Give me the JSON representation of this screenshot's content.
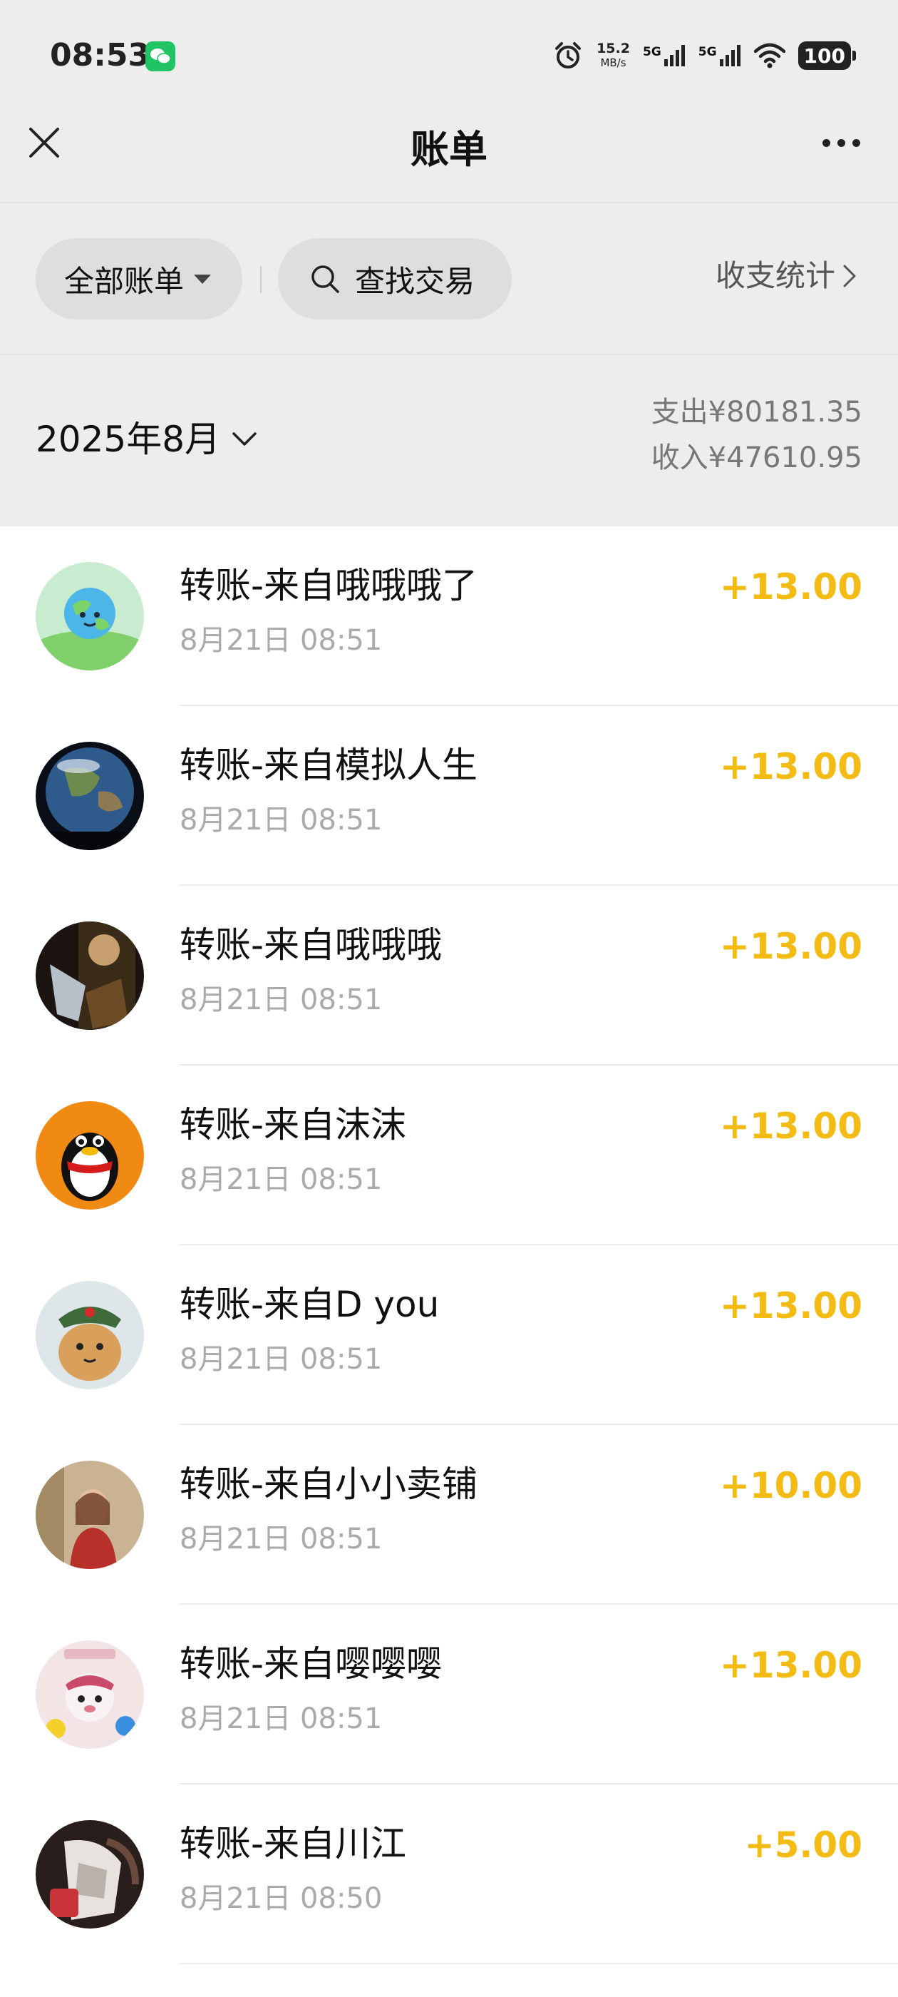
{
  "status_bar": {
    "time": "08:53",
    "app_notification_icon": "wechat-icon",
    "net_speed_value": "15.2",
    "net_speed_unit": "MB/s",
    "sim1_label": "5G",
    "sim2_label": "5G",
    "battery": "100"
  },
  "nav": {
    "title": "账单",
    "close_icon": "close-icon",
    "more_icon": "more-icon"
  },
  "filters": {
    "all_bills_label": "全部账单",
    "search_label": "查找交易",
    "stats_label": "收支统计"
  },
  "month": {
    "label": "2025年8月",
    "expense": "支出¥80181.35",
    "income": "收入¥47610.95"
  },
  "colors": {
    "amount": "#f3bb14",
    "background": "#ededed",
    "pill": "#dedede"
  },
  "transactions": [
    {
      "title": "转账-来自哦哦哦了",
      "time": "8月21日 08:51",
      "amount": "+13.00"
    },
    {
      "title": "转账-来自模拟人生",
      "time": "8月21日 08:51",
      "amount": "+13.00"
    },
    {
      "title": "转账-来自哦哦哦",
      "time": "8月21日 08:51",
      "amount": "+13.00"
    },
    {
      "title": "转账-来自沫沫",
      "time": "8月21日 08:51",
      "amount": "+13.00"
    },
    {
      "title": "转账-来自D you",
      "time": "8月21日 08:51",
      "amount": "+13.00"
    },
    {
      "title": "转账-来自小小卖铺",
      "time": "8月21日 08:51",
      "amount": "+10.00"
    },
    {
      "title": "转账-来自嘤嘤嘤",
      "time": "8月21日 08:51",
      "amount": "+13.00"
    },
    {
      "title": "转账-来自川江",
      "time": "8月21日 08:50",
      "amount": "+5.00"
    }
  ]
}
